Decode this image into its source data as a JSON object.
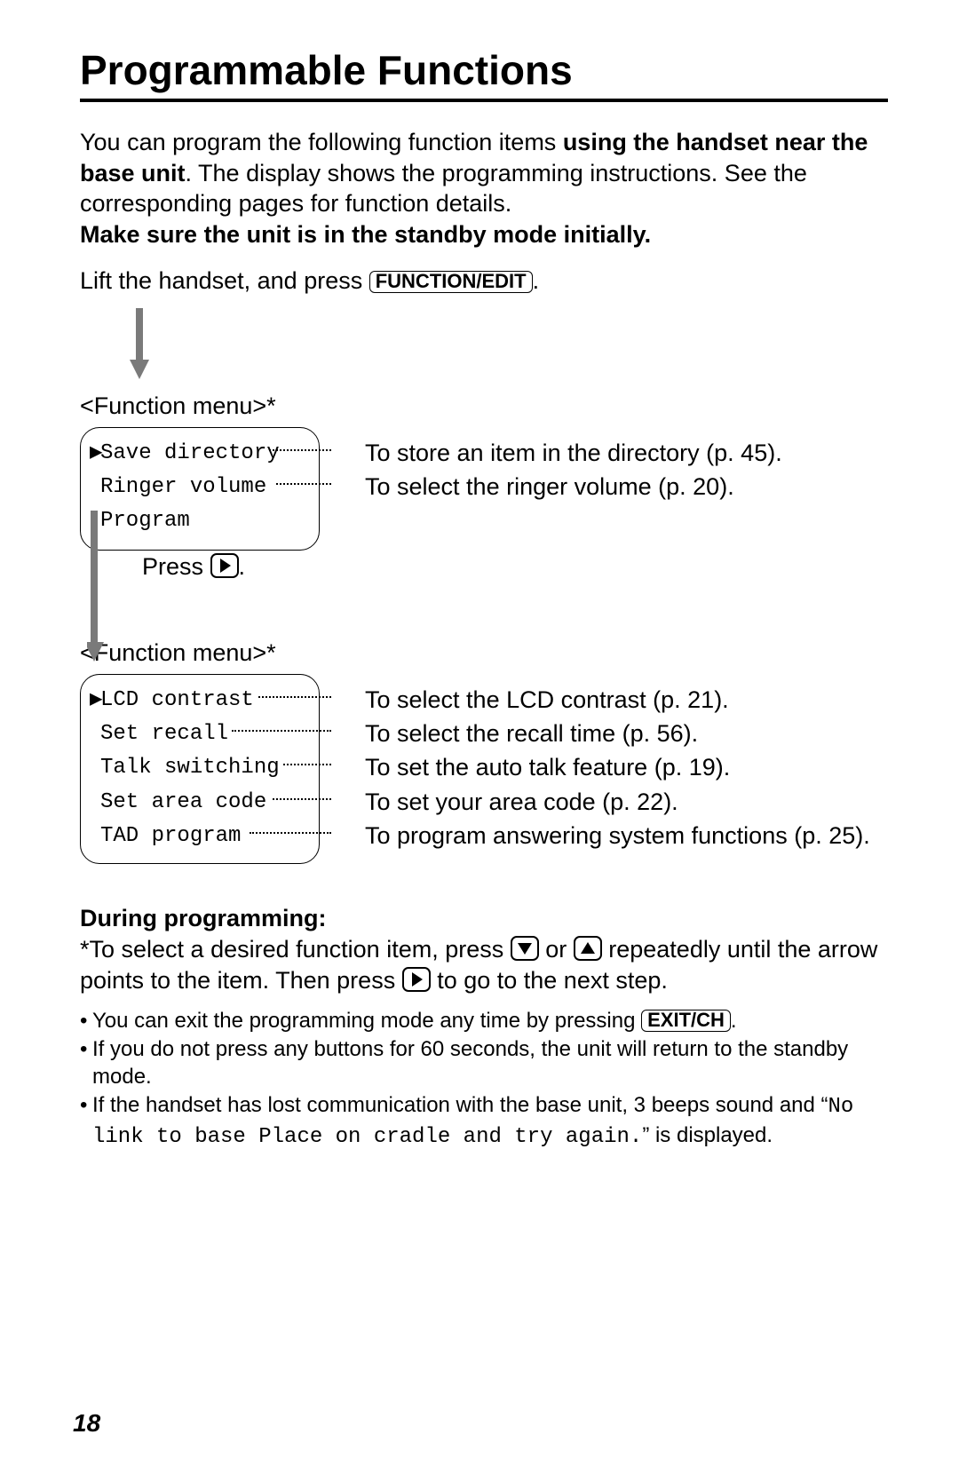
{
  "title": "Programmable Functions",
  "intro": {
    "p1_a": "You can program the following function items ",
    "p1_b_bold": "using the handset near the base unit",
    "p1_c": ". The display shows the programming instructions. See the corresponding pages for function details.",
    "p2_bold": "Make sure the unit is in the standby mode initially."
  },
  "step1": {
    "text_a": "Lift the handset, and press ",
    "button": "FUNCTION/EDIT",
    "text_b": "."
  },
  "menu1": {
    "label": "<Function menu>*",
    "items": [
      {
        "lcd": "Save directory",
        "selected": true,
        "desc": "To store an item in the directory (p. 45)."
      },
      {
        "lcd": "Ringer volume",
        "selected": false,
        "desc": "To select the ringer volume (p. 20)."
      },
      {
        "lcd": "Program",
        "selected": false,
        "desc": ""
      }
    ]
  },
  "press_right": {
    "a": "Press ",
    "b": "."
  },
  "menu2": {
    "label": "<Function menu>*",
    "items": [
      {
        "lcd": "LCD contrast",
        "selected": true,
        "desc": "To select the LCD contrast (p. 21)."
      },
      {
        "lcd": "Set recall",
        "selected": false,
        "desc": "To select the recall time (p. 56)."
      },
      {
        "lcd": "Talk switching",
        "selected": false,
        "desc": "To set the auto talk feature (p. 19)."
      },
      {
        "lcd": "Set area code",
        "selected": false,
        "desc": "To set your area code (p. 22)."
      },
      {
        "lcd": "TAD program",
        "selected": false,
        "desc": "To program answering system functions (p. 25)."
      }
    ]
  },
  "during": {
    "heading": "During programming:",
    "line1_a": "*To select a desired function item, press ",
    "line1_b": " or ",
    "line1_c": " repeatedly until the arrow points to the item. Then press ",
    "line1_d": " to go to the next step.",
    "bullets": [
      {
        "a": "You can exit the programming mode any time by pressing ",
        "button": "EXIT/CH",
        "b": "."
      },
      {
        "a": "If you do not press any buttons for 60 seconds, the unit will return to the standby mode.",
        "button": "",
        "b": ""
      },
      {
        "a": "If the handset has lost communication with the base unit, 3 beeps sound and “",
        "mono": "No link to base  Place on cradle and try again.",
        "b": "” is displayed."
      }
    ]
  },
  "page": "18"
}
